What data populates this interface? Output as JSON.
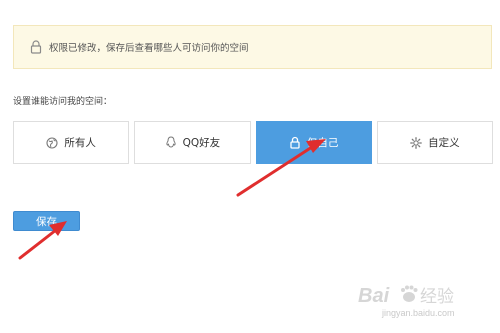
{
  "notice": {
    "text": "权限已修改，保存后查看哪些人可访问你的空间",
    "icon": "lock-icon"
  },
  "permission": {
    "label": "设置谁能访问我的空间：",
    "options": [
      {
        "label": "所有人",
        "icon": "globe-icon",
        "selected": false
      },
      {
        "label": "QQ好友",
        "icon": "qq-penguin-icon",
        "selected": false
      },
      {
        "label": "仅自己",
        "icon": "lock-icon",
        "selected": true
      },
      {
        "label": "自定义",
        "icon": "gear-icon",
        "selected": false
      }
    ]
  },
  "save": {
    "label": "保存"
  },
  "colors": {
    "accent": "#4d9de0",
    "notice_bg": "#fdf9e5",
    "arrow": "#e02e2e"
  },
  "watermark": {
    "brand": "Bai",
    "brand_suffix": "经验",
    "url": "jingyan.baidu.com"
  }
}
